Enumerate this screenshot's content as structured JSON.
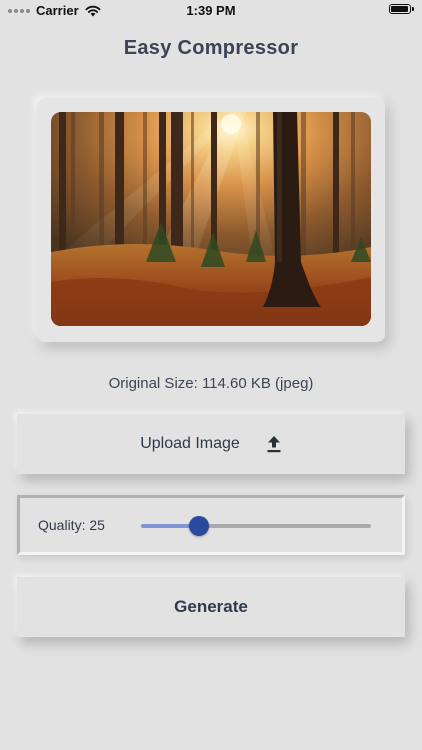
{
  "status_bar": {
    "carrier": "Carrier",
    "time": "1:39 PM",
    "battery_level": 0.92
  },
  "app": {
    "title": "Easy Compressor"
  },
  "image_info": {
    "original_size": "Original Size: 114.60 KB (jpeg)"
  },
  "upload": {
    "label": "Upload Image",
    "icon": "upload-icon"
  },
  "quality": {
    "label": "Quality: 25",
    "value": 25,
    "min": 0,
    "max": 100,
    "fill_color": "#7f95d6",
    "thumb_color": "#2b4a9e"
  },
  "generate": {
    "label": "Generate"
  }
}
